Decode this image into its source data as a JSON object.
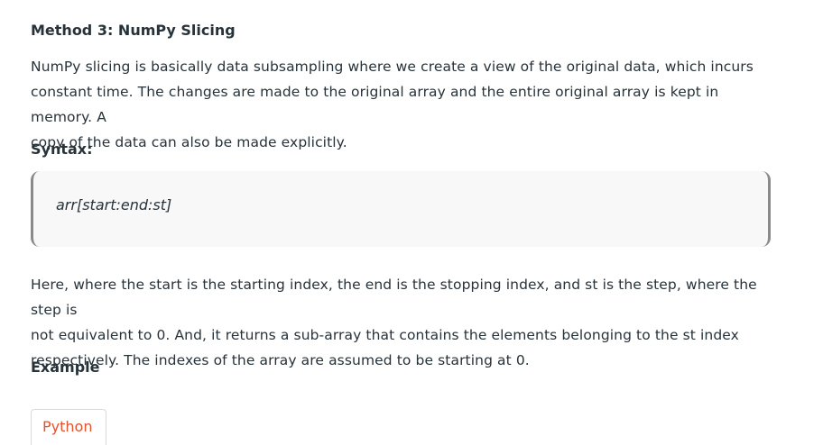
{
  "section": {
    "title": "Method 3: NumPy Slicing",
    "intro_line1": "NumPy slicing is basically data subsampling where we create a view of the original data, which incurs",
    "intro_line2": "constant time. The changes are made to the original array and the entire original array is kept in memory. A",
    "intro_line3": "copy of the data can also be made explicitly."
  },
  "syntax": {
    "heading": "Syntax:",
    "code": "arr[start:end:st]"
  },
  "explanation": {
    "line1": "Here, where the start is the starting index, the end is the stopping index, and st is the step, where the step is",
    "line2": "not equivalent to 0. And, it returns a sub-array that contains the elements belonging to the st index",
    "line3": "respectively. The indexes of the array are assumed to be starting at 0."
  },
  "example": {
    "heading": "Example",
    "tab_label": "Python"
  },
  "colors": {
    "text": "#273239",
    "code_bg": "#f8f8f8",
    "code_border": "#8a8a8a",
    "tab_text": "#e3532e"
  }
}
